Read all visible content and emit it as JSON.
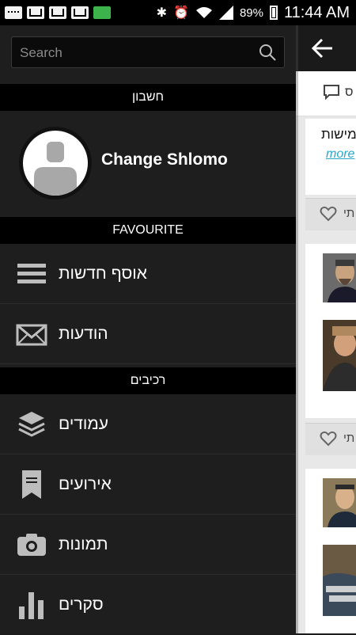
{
  "status_bar": {
    "battery_percent": "89%",
    "time": "11:44 AM"
  },
  "drawer": {
    "search": {
      "placeholder": "Search"
    },
    "account_header": "חשבון",
    "profile": {
      "name": "Change Shlomo"
    },
    "favourite_header": "FAVOURITE",
    "favourites": [
      {
        "label": "אוסף חדשות",
        "icon": "menu-lines-icon"
      },
      {
        "label": "הודעות",
        "icon": "envelope-icon"
      }
    ],
    "components_header": "רכיבים",
    "components": [
      {
        "label": "עמודים",
        "icon": "layers-icon"
      },
      {
        "label": "אירועים",
        "icon": "bookmark-icon"
      },
      {
        "label": "תמונות",
        "icon": "camera-icon"
      },
      {
        "label": "סקרים",
        "icon": "bar-chart-icon"
      }
    ]
  },
  "content": {
    "tab_text": "ס",
    "post_text": "מישות.",
    "more_link": "more",
    "like_text_1": "תי",
    "like_text_2": "תי"
  },
  "colors": {
    "drawer_bg": "#1e1e1e",
    "header_bg": "#000000",
    "link": "#2aa7c9"
  }
}
